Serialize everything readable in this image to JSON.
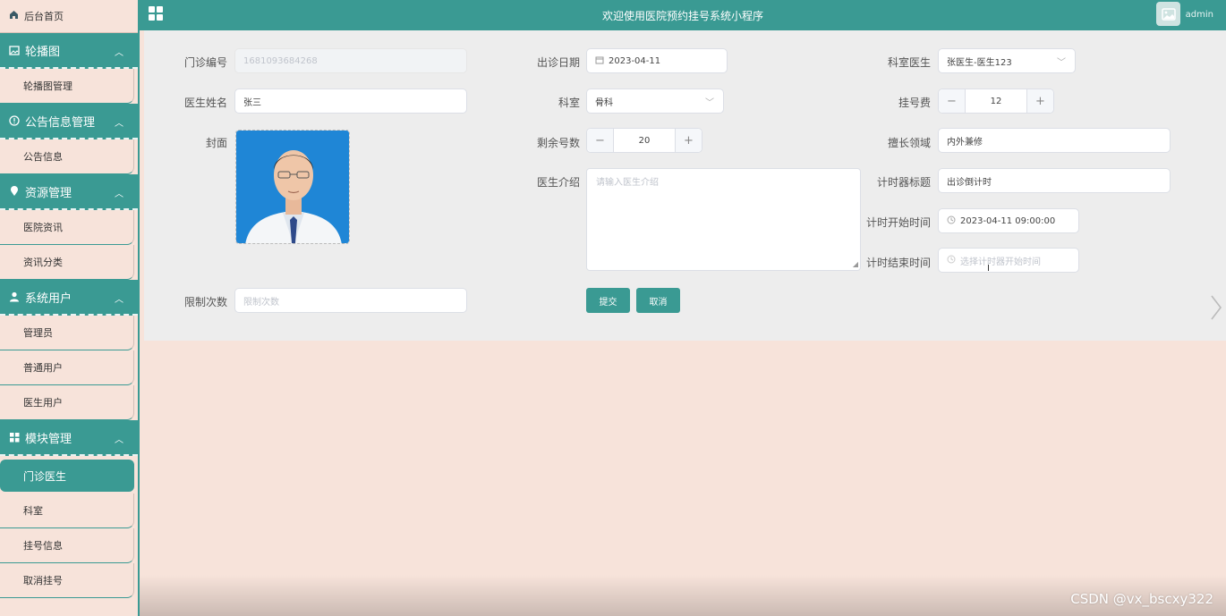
{
  "sidebar": {
    "home": "后台首页",
    "groups": [
      {
        "title": "轮播图",
        "icon": "image-icon",
        "items": [
          "轮播图管理"
        ]
      },
      {
        "title": "公告信息管理",
        "icon": "info-icon",
        "items": [
          "公告信息"
        ]
      },
      {
        "title": "资源管理",
        "icon": "location-icon",
        "items": [
          "医院资讯",
          "资讯分类"
        ]
      },
      {
        "title": "系统用户",
        "icon": "user-icon",
        "items": [
          "管理员",
          "普通用户",
          "医生用户"
        ]
      },
      {
        "title": "模块管理",
        "icon": "grid-icon",
        "items": [
          "门诊医生",
          "科室",
          "挂号信息",
          "取消挂号"
        ]
      }
    ],
    "active_item": "门诊医生"
  },
  "header": {
    "title": "欢迎使用医院预约挂号系统小程序",
    "username": "admin"
  },
  "form": {
    "clinic_no": {
      "label": "门诊编号",
      "value": "1681093684268"
    },
    "visit_date": {
      "label": "出诊日期",
      "value": "2023-04-11"
    },
    "dept_doctor": {
      "label": "科室医生",
      "value": "张医生-医生123"
    },
    "doctor_name": {
      "label": "医生姓名",
      "value": "张三"
    },
    "department": {
      "label": "科室",
      "value": "骨科"
    },
    "reg_fee": {
      "label": "挂号费",
      "value": "12",
      "minus": "−",
      "plus": "+"
    },
    "cover": {
      "label": "封面"
    },
    "remaining": {
      "label": "剩余号数",
      "value": "20",
      "minus": "−",
      "plus": "+"
    },
    "specialty": {
      "label": "擅长领域",
      "value": "内外兼修"
    },
    "intro": {
      "label": "医生介绍",
      "placeholder": "请输入医生介绍"
    },
    "timer_title": {
      "label": "计时器标题",
      "value": "出诊倒计时"
    },
    "timer_start": {
      "label": "计时开始时间",
      "value": "2023-04-11 09:00:00"
    },
    "timer_end": {
      "label": "计时结束时间",
      "placeholder": "选择计时器开始时间"
    },
    "limit": {
      "label": "限制次数",
      "placeholder": "限制次数"
    },
    "submit": "提交",
    "cancel": "取消"
  },
  "watermark": "CSDN @vx_bscxy322",
  "colors": {
    "accent": "#3a9a93",
    "sidebar_bg": "#f7e3da",
    "panel_bg": "#ededed"
  }
}
